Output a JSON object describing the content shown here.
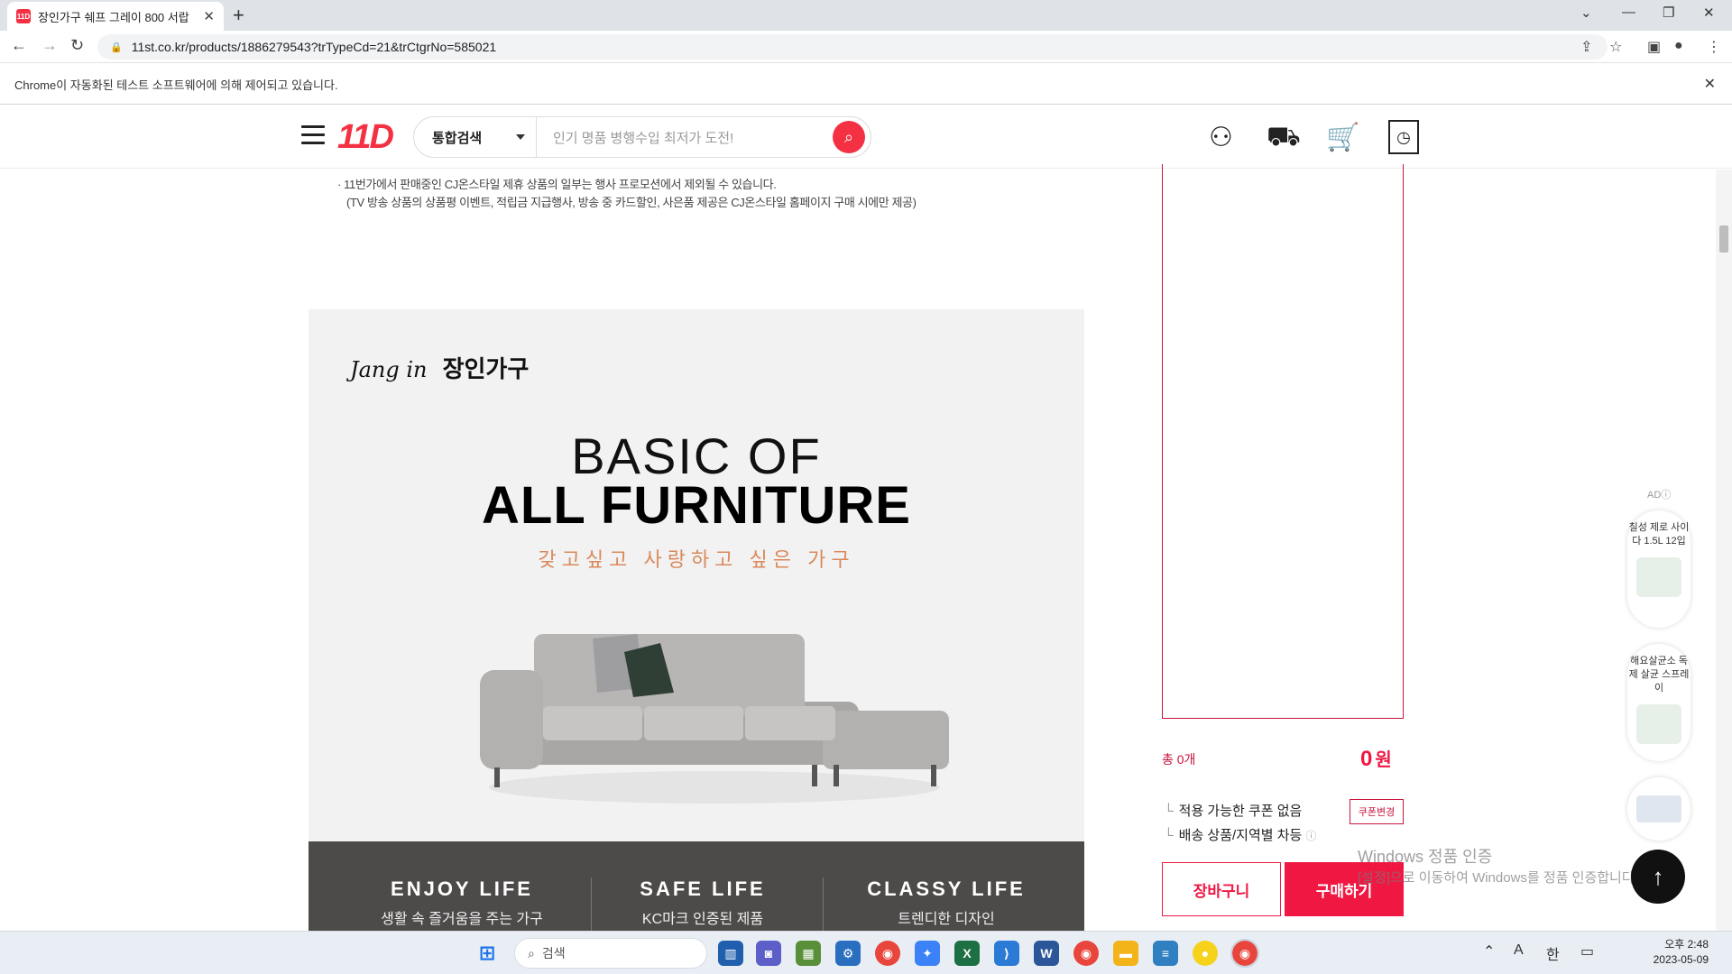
{
  "browser": {
    "tab_title": "장인가구 쉐프 그레이 800 서랍",
    "favicon_text": "11D",
    "url": "11st.co.kr/products/1886279543?trTypeCd=21&trCtgrNo=585021",
    "infobar": "Chrome이 자동화된 테스트 소프트웨어에 의해 제어되고 있습니다."
  },
  "site": {
    "logo": "11D",
    "search_category": "통합검색",
    "search_placeholder": "인기 명품 병행수입 최저가 도전!"
  },
  "content": {
    "notice_line1": "· 11번가에서 판매중인 CJ온스타일 제휴 상품의 일부는 행사 프로모션에서 제외될 수 있습니다.",
    "notice_line2": "(TV 방송 상품의 상품평 이벤트, 적립금 지급행사, 방송 중 카드할인, 사은품 제공은 CJ온스타일 홈페이지 구매 시에만 제공)",
    "banner": {
      "brand_script": "Jang in",
      "brand_name": "장인가구",
      "line1": "BASIC OF",
      "line2": "ALL FURNITURE",
      "line3": "갖고싶고 사랑하고 싶은 가구",
      "features": [
        {
          "title": "ENJOY LIFE",
          "sub": "생활 속 즐거움을 주는 가구"
        },
        {
          "title": "SAFE LIFE",
          "sub": "KC마크 인증된 제품"
        },
        {
          "title": "CLASSY LIFE",
          "sub": "트렌디한 디자인"
        }
      ]
    }
  },
  "order": {
    "total_count": "총 0개",
    "price_value": "0",
    "price_unit": "원",
    "coupon_note": "적용 가능한 쿠폰 없음",
    "coupon_button": "쿠폰변경",
    "shipping_note": "배송 상품/지역별 차등",
    "cart_button": "장바구니",
    "buy_button": "구매하기"
  },
  "ads": {
    "label": "AD",
    "items": [
      {
        "text": "칠성 제로 사이다 1.5L 12입"
      },
      {
        "text": "해요살균소 독제 살균 스프레이"
      }
    ]
  },
  "watermark": {
    "line1": "Windows 정품 인증",
    "line2": "[설정]으로 이동하여 Windows를 정품 인증합니다."
  },
  "taskbar": {
    "search_label": "검색",
    "time": "오후 2:48",
    "date": "2023-05-09",
    "ime1": "A",
    "ime2": "한"
  }
}
